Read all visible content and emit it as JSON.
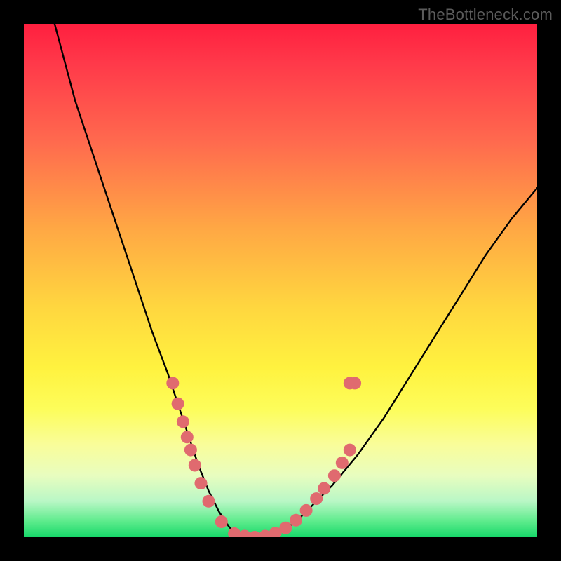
{
  "watermark": "TheBottleneck.com",
  "chart_data": {
    "type": "line",
    "title": "",
    "xlabel": "",
    "ylabel": "",
    "xlim": [
      0,
      100
    ],
    "ylim": [
      0,
      100
    ],
    "series": [
      {
        "name": "curve",
        "x": [
          6,
          10,
          15,
          20,
          25,
          28,
          30,
          32,
          34,
          36,
          38,
          40,
          42,
          45,
          48,
          50,
          53,
          56,
          60,
          65,
          70,
          75,
          80,
          85,
          90,
          95,
          100
        ],
        "y": [
          100,
          85,
          70,
          55,
          40,
          32,
          26,
          20,
          14,
          9,
          5,
          2,
          0,
          0,
          0,
          1,
          3,
          6,
          10,
          16,
          23,
          31,
          39,
          47,
          55,
          62,
          68
        ]
      }
    ],
    "markers": {
      "name": "dots",
      "color": "#e06a6f",
      "radius": 9,
      "points": [
        {
          "x": 29.0,
          "y": 30.0
        },
        {
          "x": 30.0,
          "y": 26.0
        },
        {
          "x": 31.0,
          "y": 22.5
        },
        {
          "x": 31.8,
          "y": 19.5
        },
        {
          "x": 32.5,
          "y": 17.0
        },
        {
          "x": 33.3,
          "y": 14.0
        },
        {
          "x": 34.5,
          "y": 10.5
        },
        {
          "x": 36.0,
          "y": 7.0
        },
        {
          "x": 38.5,
          "y": 3.0
        },
        {
          "x": 41.0,
          "y": 0.7
        },
        {
          "x": 43.0,
          "y": 0.2
        },
        {
          "x": 45.0,
          "y": 0.0
        },
        {
          "x": 47.0,
          "y": 0.2
        },
        {
          "x": 49.0,
          "y": 0.8
        },
        {
          "x": 51.0,
          "y": 1.8
        },
        {
          "x": 53.0,
          "y": 3.3
        },
        {
          "x": 55.0,
          "y": 5.2
        },
        {
          "x": 57.0,
          "y": 7.5
        },
        {
          "x": 58.5,
          "y": 9.5
        },
        {
          "x": 60.5,
          "y": 12.0
        },
        {
          "x": 62.0,
          "y": 14.5
        },
        {
          "x": 63.5,
          "y": 17.0
        },
        {
          "x": 63.5,
          "y": 30.0
        },
        {
          "x": 64.5,
          "y": 30.0
        }
      ]
    }
  }
}
